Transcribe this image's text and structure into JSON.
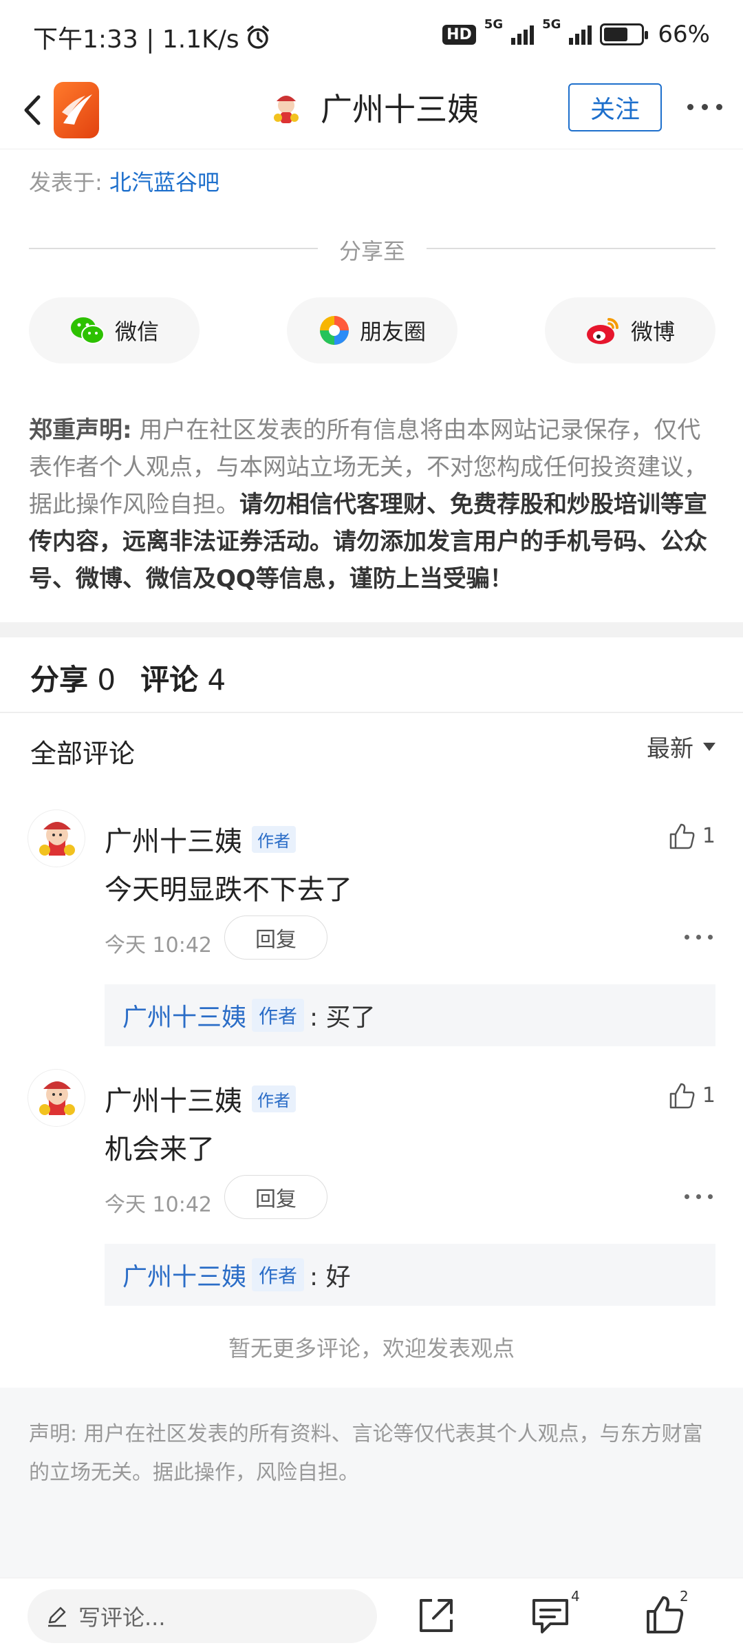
{
  "status_bar": {
    "time_speed": "下午1:33 | 1.1K/s",
    "hd": "HD",
    "net1": "5G",
    "net2": "5G",
    "battery": "66%",
    "battery_level": 0.66
  },
  "header": {
    "title": "广州十三姨",
    "follow_label": "关注"
  },
  "post": {
    "published_prefix": "发表于: ",
    "published_link": "北汽蓝谷吧"
  },
  "share": {
    "label": "分享至",
    "buttons": [
      {
        "label": "微信",
        "icon": "wechat-icon"
      },
      {
        "label": "朋友圈",
        "icon": "moments-icon"
      },
      {
        "label": "微博",
        "icon": "weibo-icon"
      }
    ]
  },
  "disclaimer": {
    "title": "郑重声明:",
    "normal": " 用户在社区发表的所有信息将由本网站记录保存，仅代表作者个人观点，与本网站立场无关，不对您构成任何投资建议，据此操作风险自担。",
    "bold": "请勿相信代客理财、免费荐股和炒股培训等宣传内容，远离非法证券活动。请勿添加发言用户的手机号码、公众号、微博、微信及QQ等信息，谨防上当受骗！"
  },
  "stats": {
    "share_label": "分享",
    "share_count": "0",
    "comment_label": "评论",
    "comment_count": "4"
  },
  "comments_header": {
    "title": "全部评论",
    "sort": "最新"
  },
  "comments": [
    {
      "name": "广州十三姨",
      "tag": "作者",
      "likes": "1",
      "body": "今天明显跌不下去了",
      "time": "今天 10:42",
      "reply_label": "回复",
      "sub_name": "广州十三姨",
      "sub_tag": "作者",
      "sub_text": ": 买了"
    },
    {
      "name": "广州十三姨",
      "tag": "作者",
      "likes": "1",
      "body": "机会来了",
      "time": "今天 10:42",
      "reply_label": "回复",
      "sub_name": "广州十三姨",
      "sub_tag": "作者",
      "sub_text": ": 好"
    }
  ],
  "no_more": "暂无更多评论，欢迎发表观点",
  "footer_note": "声明: 用户在社区发表的所有资料、言论等仅代表其个人观点，与东方财富的立场无关。据此操作，风险自担。",
  "bottom_bar": {
    "write_placeholder": "写评论...",
    "comment_badge": "4",
    "like_badge": "2"
  }
}
